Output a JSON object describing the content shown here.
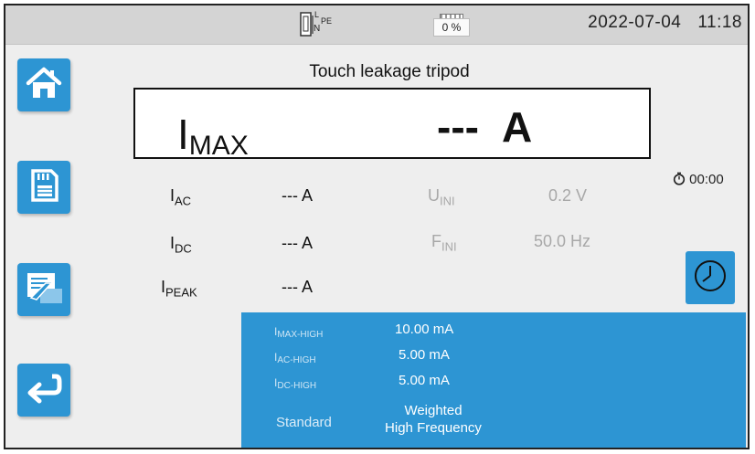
{
  "status": {
    "term_label": "PE",
    "term_label_n": "N",
    "battery_percent": "0 %",
    "date": "2022-07-04",
    "time": "11:18"
  },
  "sidebar": {
    "home": "home-icon",
    "memory": "memory-card-icon",
    "report": "report-icon",
    "back": "back-arrow-icon"
  },
  "main": {
    "title": "Touch leakage tripod",
    "imax_label": "I",
    "imax_sub": "MAX",
    "imax_value": "--- A"
  },
  "measurements": {
    "iac_label": "I",
    "iac_sub": "AC",
    "iac_value": "--- A",
    "idc_label": "I",
    "idc_sub": "DC",
    "idc_value": "--- A",
    "ipeak_label": "I",
    "ipeak_sub": "PEAK",
    "ipeak_value": "--- A",
    "uini_label": "U",
    "uini_sub": "INI",
    "uini_value": "0.2 V",
    "fini_label": "F",
    "fini_sub": "INI",
    "fini_value": "50.0 Hz"
  },
  "timer": "00:00",
  "limits": {
    "imax_high_label": "I",
    "imax_high_sub": "MAX-HIGH",
    "imax_high_value": "10.00 mA",
    "iac_high_label": "I",
    "iac_high_sub": "AC-HIGH",
    "iac_high_value": "5.00 mA",
    "idc_high_label": "I",
    "idc_high_sub": "DC-HIGH",
    "idc_high_value": "5.00 mA",
    "standard_label": "Standard",
    "standard_value_1": "Weighted",
    "standard_value_2": "High Frequency"
  },
  "colors": {
    "accent": "#2d95d3",
    "status_bar": "#d4d4d4",
    "background": "#eeeeee"
  }
}
